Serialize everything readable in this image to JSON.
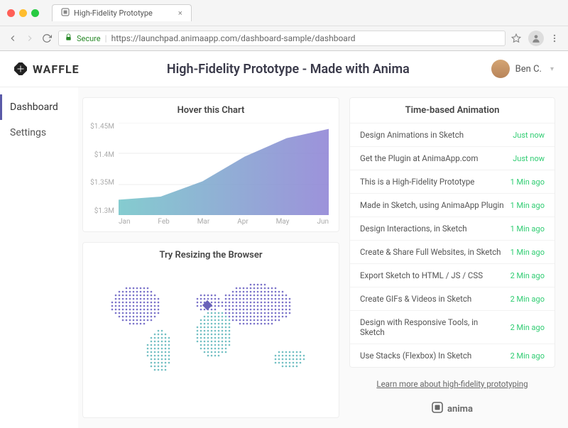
{
  "browser": {
    "tab_title": "High-Fidelity Prototype",
    "secure_label": "Secure",
    "url": "https://launchpad.animaapp.com/dashboard-sample/dashboard"
  },
  "header": {
    "brand": "WAFFLE",
    "title": "High-Fidelity Prototype - Made with Anima",
    "user_name": "Ben C."
  },
  "sidebar": {
    "items": [
      {
        "label": "Dashboard",
        "active": true
      },
      {
        "label": "Settings",
        "active": false
      }
    ]
  },
  "chart_data": {
    "type": "area",
    "title": "Hover this Chart",
    "categories": [
      "Jan",
      "Feb",
      "Mar",
      "Apr",
      "May",
      "Jun"
    ],
    "values": [
      1.325,
      1.33,
      1.355,
      1.395,
      1.425,
      1.44
    ],
    "y_ticks": [
      "$1.45M",
      "$1.4M",
      "$1.35M",
      "$1.3M"
    ],
    "ylim": [
      1.3,
      1.45
    ],
    "xlabel": "",
    "ylabel": ""
  },
  "map": {
    "title": "Try Resizing the Browser"
  },
  "timeline": {
    "title": "Time-based Animation",
    "items": [
      {
        "text": "Design Animations in Sketch",
        "time": "Just now"
      },
      {
        "text": "Get the Plugin at AnimaApp.com",
        "time": "Just now"
      },
      {
        "text": "This is a High-Fidelity Prototype",
        "time": "1 Min ago"
      },
      {
        "text": "Made in Sketch, using AnimaApp Plugin",
        "time": "1 Min ago"
      },
      {
        "text": "Design Interactions, in Sketch",
        "time": "1 Min ago"
      },
      {
        "text": "Create & Share Full Websites, in Sketch",
        "time": "1 Min ago"
      },
      {
        "text": "Export Sketch to HTML / JS / CSS",
        "time": "2 Min ago"
      },
      {
        "text": "Create GIFs & Videos in Sketch",
        "time": "2 Min ago"
      },
      {
        "text": "Design with Responsive Tools, in Sketch",
        "time": "2 Min ago"
      },
      {
        "text": "Use Stacks (Flexbox) In Sketch",
        "time": "2 Min ago"
      }
    ]
  },
  "footer": {
    "learn_link": "Learn more about high-fidelity prototyping",
    "brand": "anima"
  }
}
